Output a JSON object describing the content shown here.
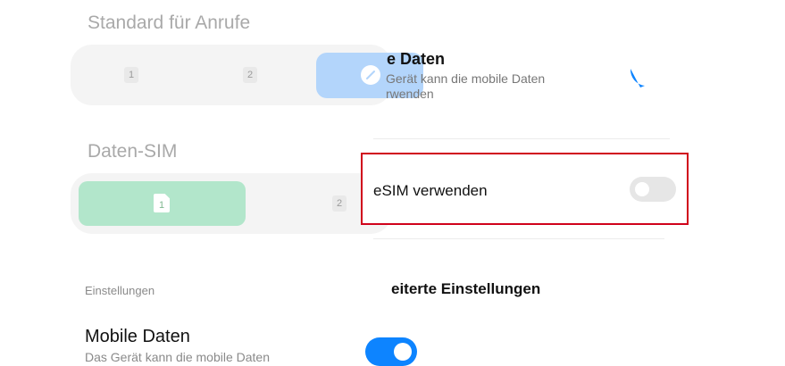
{
  "calls": {
    "title": "Standard für Anrufe",
    "sim1": "1",
    "sim2": "2"
  },
  "data_sim": {
    "title": "Daten-SIM",
    "sim1": "1",
    "sim2": "2"
  },
  "popup": {
    "mobile_data_title": "e Daten",
    "mobile_data_desc_line1": "Gerät kann die mobile Daten",
    "mobile_data_desc_line2": "rwenden",
    "esim_label": "eSIM verwenden",
    "esim_enabled": false,
    "advanced_settings": "eiterte Einstellungen"
  },
  "settings": {
    "header": "Einstellungen",
    "mobile_data_title": "Mobile Daten",
    "mobile_data_desc": "Das Gerät kann die mobile Daten",
    "mobile_data_enabled": true
  },
  "colors": {
    "accent": "#0d84ff",
    "selected_call_sim": "#b3d5fb",
    "selected_data_sim": "#b2e6cb",
    "highlight_box": "#d0021b"
  }
}
